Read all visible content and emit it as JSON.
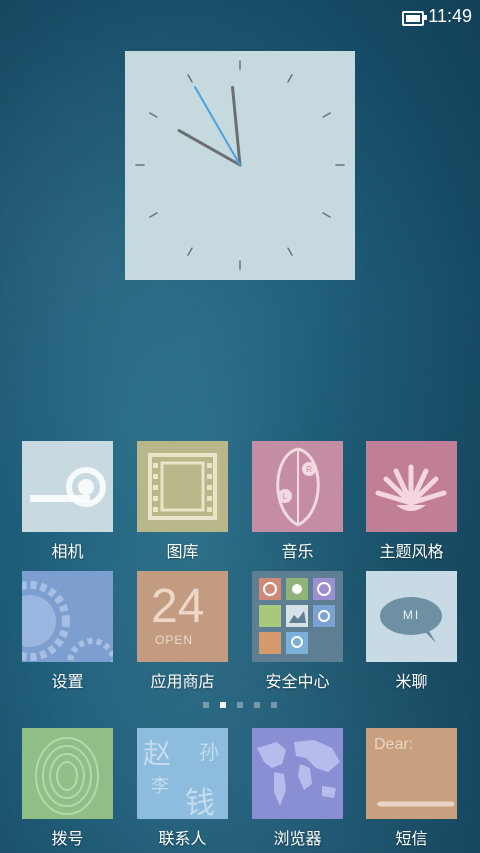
{
  "status_bar": {
    "time": "11:49"
  },
  "clock": {
    "hour": 11,
    "minute": 49,
    "second": 55
  },
  "apps_row1": [
    {
      "label": "相机",
      "icon": "camera-icon",
      "color": "#c9d9e0"
    },
    {
      "label": "图库",
      "icon": "gallery-icon",
      "color": "#b8b78a"
    },
    {
      "label": "音乐",
      "icon": "music-icon",
      "color": "#c48da4"
    },
    {
      "label": "主题风格",
      "icon": "theme-icon",
      "color": "#c07f96"
    }
  ],
  "apps_row2": [
    {
      "label": "设置",
      "icon": "settings-icon",
      "color": "#7d9fcf"
    },
    {
      "label": "应用商店",
      "icon": "app-store-icon",
      "color": "#c39b80",
      "number": "24",
      "subtext": "OPEN"
    },
    {
      "label": "安全中心",
      "icon": "security-center-icon",
      "color": "#5e7f93"
    },
    {
      "label": "米聊",
      "icon": "mi-talk-icon",
      "color": "#c8dbe4",
      "bubble_text": "MI"
    }
  ],
  "dock": [
    {
      "label": "拨号",
      "icon": "phone-icon",
      "color": "#8fbf86"
    },
    {
      "label": "联系人",
      "icon": "contacts-icon",
      "color": "#8dbcde",
      "chars": [
        "赵",
        "孙",
        "李",
        "钱"
      ]
    },
    {
      "label": "浏览器",
      "icon": "browser-icon",
      "color": "#8a8fd4"
    },
    {
      "label": "短信",
      "icon": "messaging-icon",
      "color": "#c9a07f",
      "note_text": "Dear:"
    }
  ],
  "pages": {
    "count": 5,
    "active": 1
  }
}
